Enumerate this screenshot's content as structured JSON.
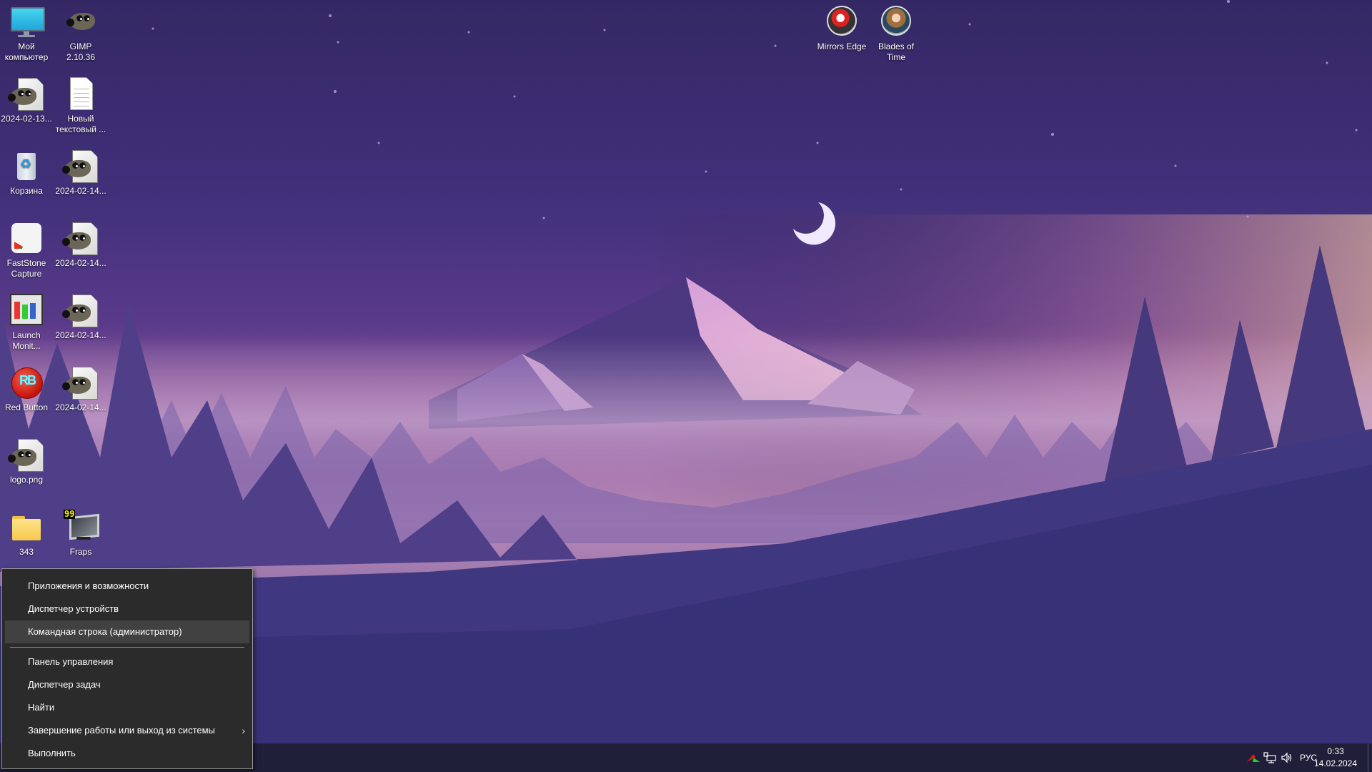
{
  "desktop": {
    "icons": [
      {
        "id": "my-computer",
        "label": "Мой компьютер",
        "icon": "monitor-icon"
      },
      {
        "id": "gimp",
        "label": "GIMP 2.10.36",
        "icon": "gimp-wilber-icon"
      },
      {
        "id": "file-20240213",
        "label": "2024-02-13...",
        "icon": "gimp-document-icon"
      },
      {
        "id": "new-text",
        "label": "Новый текстовый ...",
        "icon": "text-document-icon"
      },
      {
        "id": "recycle-bin",
        "label": "Корзина",
        "icon": "recycle-bin-icon"
      },
      {
        "id": "file-20240214-a",
        "label": "2024-02-14...",
        "icon": "gimp-document-icon"
      },
      {
        "id": "faststone",
        "label": "FastStone Capture",
        "icon": "faststone-capture-icon"
      },
      {
        "id": "file-20240214-b",
        "label": "2024-02-14...",
        "icon": "gimp-document-icon"
      },
      {
        "id": "launch-monitor",
        "label": "Launch Monit...",
        "icon": "launch-monitor-icon"
      },
      {
        "id": "file-20240214-c",
        "label": "2024-02-14...",
        "icon": "gimp-document-icon"
      },
      {
        "id": "red-button",
        "label": "Red Button",
        "icon": "red-button-icon"
      },
      {
        "id": "file-20240214-d",
        "label": "2024-02-14...",
        "icon": "gimp-document-icon"
      },
      {
        "id": "logo-png",
        "label": "logo.png",
        "icon": "gimp-document-icon"
      },
      {
        "id": "folder-343",
        "label": "343",
        "icon": "folder-icon"
      },
      {
        "id": "fraps",
        "label": "Fraps",
        "icon": "fraps-icon",
        "badge": "99"
      },
      {
        "id": "mirrors-edge",
        "label": "Mirrors Edge",
        "icon": "mirrors-edge-icon"
      },
      {
        "id": "blades-of-time",
        "label": "Blades of Time",
        "icon": "blades-of-time-icon"
      }
    ]
  },
  "context_menu": {
    "items": [
      {
        "label": "Приложения и возможности"
      },
      {
        "label": "Диспетчер устройств"
      },
      {
        "label": "Командная строка (администратор)",
        "highlighted": true
      },
      {
        "label": "Панель управления"
      },
      {
        "label": "Диспетчер задач"
      },
      {
        "label": "Найти"
      },
      {
        "label": "Завершение работы или выход из системы",
        "submenu": true
      },
      {
        "label": "Выполнить"
      }
    ],
    "submenu_arrow": "›"
  },
  "taskbar": {
    "tray": {
      "language": "РУС",
      "icons": [
        "app-tray-icon",
        "network-icon",
        "volume-icon"
      ]
    },
    "clock": {
      "time": "0:33",
      "date": "14.02.2024"
    }
  },
  "colors": {
    "menu_bg": "#2b2b2b",
    "menu_highlight": "#414141",
    "taskbar_bg": "#1e1e34"
  }
}
